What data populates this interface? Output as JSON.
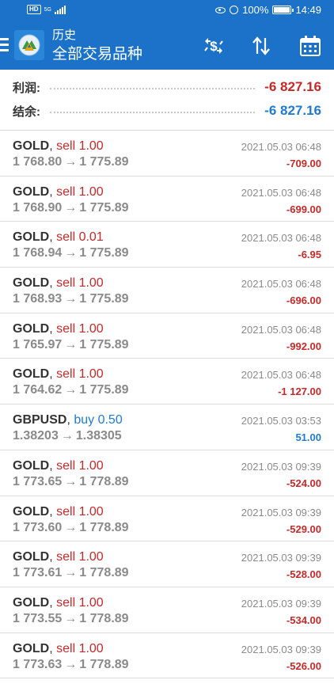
{
  "status_bar": {
    "network": "5G",
    "battery": "100%",
    "time": "14:49"
  },
  "header": {
    "title_sub": "历史",
    "title_main": "全部交易品种",
    "icons": [
      "currency-exchange-icon",
      "sort-icon",
      "calendar-icon"
    ]
  },
  "summary": {
    "profit_label": "利润:",
    "profit_value": "-6 827.16",
    "balance_label": "结余:",
    "balance_value": "-6 827.16"
  },
  "colors": {
    "primary": "#1b72c8",
    "loss": "#c82828",
    "gain": "#1f7bd0"
  },
  "trades": [
    {
      "symbol": "GOLD",
      "side": "sell",
      "volume": "1.00",
      "open": "1 768.80",
      "close": "1 775.89",
      "time": "2021.05.03 06:48",
      "profit": "-709.00"
    },
    {
      "symbol": "GOLD",
      "side": "sell",
      "volume": "1.00",
      "open": "1 768.90",
      "close": "1 775.89",
      "time": "2021.05.03 06:48",
      "profit": "-699.00"
    },
    {
      "symbol": "GOLD",
      "side": "sell",
      "volume": "0.01",
      "open": "1 768.94",
      "close": "1 775.89",
      "time": "2021.05.03 06:48",
      "profit": "-6.95"
    },
    {
      "symbol": "GOLD",
      "side": "sell",
      "volume": "1.00",
      "open": "1 768.93",
      "close": "1 775.89",
      "time": "2021.05.03 06:48",
      "profit": "-696.00"
    },
    {
      "symbol": "GOLD",
      "side": "sell",
      "volume": "1.00",
      "open": "1 765.97",
      "close": "1 775.89",
      "time": "2021.05.03 06:48",
      "profit": "-992.00"
    },
    {
      "symbol": "GOLD",
      "side": "sell",
      "volume": "1.00",
      "open": "1 764.62",
      "close": "1 775.89",
      "time": "2021.05.03 06:48",
      "profit": "-1 127.00"
    },
    {
      "symbol": "GBPUSD",
      "side": "buy",
      "volume": "0.50",
      "open": "1.38203",
      "close": "1.38305",
      "time": "2021.05.03 03:53",
      "profit": "51.00"
    },
    {
      "symbol": "GOLD",
      "side": "sell",
      "volume": "1.00",
      "open": "1 773.65",
      "close": "1 778.89",
      "time": "2021.05.03 09:39",
      "profit": "-524.00"
    },
    {
      "symbol": "GOLD",
      "side": "sell",
      "volume": "1.00",
      "open": "1 773.60",
      "close": "1 778.89",
      "time": "2021.05.03 09:39",
      "profit": "-529.00"
    },
    {
      "symbol": "GOLD",
      "side": "sell",
      "volume": "1.00",
      "open": "1 773.61",
      "close": "1 778.89",
      "time": "2021.05.03 09:39",
      "profit": "-528.00"
    },
    {
      "symbol": "GOLD",
      "side": "sell",
      "volume": "1.00",
      "open": "1 773.55",
      "close": "1 778.89",
      "time": "2021.05.03 09:39",
      "profit": "-534.00"
    },
    {
      "symbol": "GOLD",
      "side": "sell",
      "volume": "1.00",
      "open": "1 773.63",
      "close": "1 778.89",
      "time": "2021.05.03 09:39",
      "profit": "-526.00"
    }
  ]
}
